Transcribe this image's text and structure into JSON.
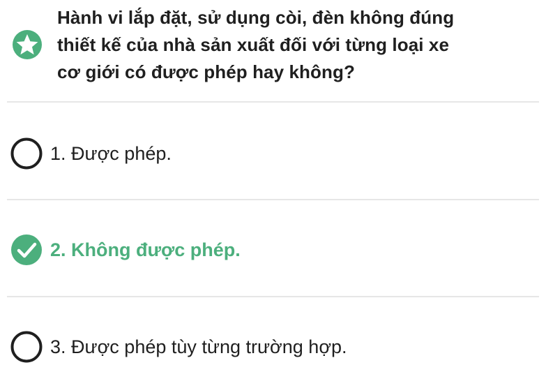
{
  "question": {
    "icon": "star-badge-icon",
    "lines": [
      "Hành vi lắp đặt, sử dụng còi, đèn không đúng",
      "thiết kế của nhà sản xuất đối với từng loại xe",
      "cơ giới có được phép hay không?"
    ]
  },
  "answers": [
    {
      "label": "1. Được phép.",
      "selected": false,
      "icon": "radio-empty-icon"
    },
    {
      "label": "2. Không được phép.",
      "selected": true,
      "icon": "check-circle-icon"
    },
    {
      "label": "3. Được phép tùy từng trường hợp.",
      "selected": false,
      "icon": "radio-empty-icon"
    }
  ],
  "colors": {
    "accent": "#4caf7d",
    "text": "#1f1f1f",
    "divider": "#e6e6e6"
  }
}
